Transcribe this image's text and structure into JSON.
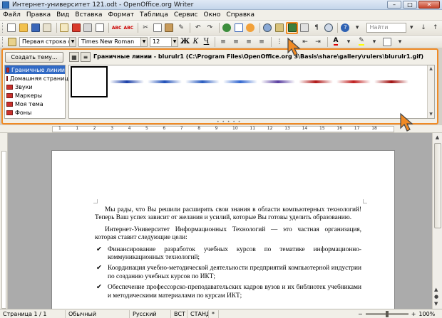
{
  "window": {
    "title": "Интернет-университет 121.odt - OpenOffice.org Writer"
  },
  "menu": [
    "Файл",
    "Правка",
    "Вид",
    "Вставка",
    "Формат",
    "Таблица",
    "Сервис",
    "Окно",
    "Справка"
  ],
  "toolbar": {
    "find_placeholder": "Найти",
    "style_value": "Первая строка с отст",
    "font_value": "Times New Roman",
    "size_value": "12",
    "bold": "Ж",
    "italic": "К",
    "underline": "Ч"
  },
  "gallery": {
    "new_theme_button": "Создать тему...",
    "themes": [
      "Граничные линии",
      "Домашняя страница",
      "Звуки",
      "Маркеры",
      "Моя тема",
      "Фоны"
    ],
    "selected_theme": "Граничные линии",
    "path": "Граничные линии - blurulr1 (C:\\Program Files\\OpenOffice.org 3\\Basis\\share\\gallery\\rulers\\blurulr1.gif)",
    "rule_colors": [
      "#ffffff",
      "#1a3fa8",
      "#1f4fb8",
      "#2a5cc0",
      "#3468d0",
      "#5a3fa0",
      "#b01818",
      "#c02020",
      "#a01010"
    ]
  },
  "ruler": {
    "ticks": [
      "1",
      "1",
      "2",
      "3",
      "4",
      "5",
      "6",
      "7",
      "8",
      "9",
      "10",
      "11",
      "12",
      "13",
      "14",
      "15",
      "16",
      "17",
      "18"
    ]
  },
  "document": {
    "p1": "Мы рады, что Вы решили расширить свои знания в области компьютерных технологий! Теперь Ваш успех зависит от желания и усилий, которые Вы готовы уделить образованию.",
    "p2": "Интернет-Университет Информационных Технологий — это частная организация, которая ставит следующие цели:",
    "bullets": [
      "Финансирование разработок учебных курсов по тематике информационно-коммуникационных технологий;",
      "Координация учебно-методической деятельности предприятий компьютерной индустрии по созданию учебных курсов по ИКТ;",
      "Обеспечение профессорско-преподавательских кадров вузов и их библиотек учебниками и методическими материалами по курсам ИКТ;"
    ]
  },
  "status": {
    "page": "Страница 1 / 1",
    "style": "Обычный",
    "language": "Русский",
    "insert": "ВСТ",
    "selection": "СТАНД",
    "zoom": "100%",
    "zoom_level": 0.5
  }
}
